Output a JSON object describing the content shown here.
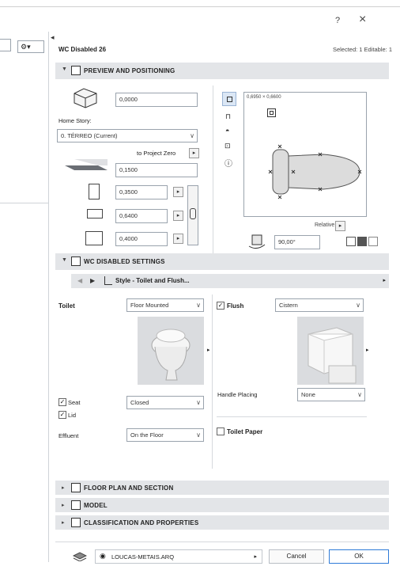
{
  "window": {
    "help": "?",
    "close": "×"
  },
  "sidebar": {
    "gear": "⚙▾"
  },
  "header": {
    "title": "WC Disabled 26",
    "selection": "Selected: 1 Editable: 1"
  },
  "preview_section": {
    "label": "PREVIEW AND POSITIONING",
    "elevation": "0,0000",
    "home_story_label": "Home Story:",
    "home_story_value": "0. TÉRREO (Current)",
    "to_project_zero": "to Project Zero",
    "offset": "0,1500",
    "width": "0,3500",
    "depth": "0,6400",
    "height": "0,4000",
    "size_readout": "0,6950 × 0,6600",
    "relative_label": "Relative",
    "angle": "90,00°"
  },
  "settings_section": {
    "label": "WC DISABLED SETTINGS",
    "style_label": "Style - Toilet and Flush..."
  },
  "toilet": {
    "label": "Toilet",
    "mount": "Floor Mounted",
    "seat_label": "Seat",
    "seat_value": "Closed",
    "lid_label": "Lid",
    "effluent_label": "Effluent",
    "effluent_value": "On the Floor"
  },
  "flush": {
    "label": "Flush",
    "type": "Cistern",
    "handle_label": "Handle Placing",
    "handle_value": "None",
    "paper_label": "Toilet Paper"
  },
  "collapsed_sections": [
    {
      "label": "FLOOR PLAN AND SECTION"
    },
    {
      "label": "MODEL"
    },
    {
      "label": "CLASSIFICATION AND PROPERTIES"
    }
  ],
  "footer": {
    "layer": "LOUCAS-METAIS.ARQ",
    "cancel": "Cancel",
    "ok": "OK"
  },
  "colors": {
    "accent": "#2f7bd8",
    "section_bg": "#e3e5e8",
    "border": "#9aa3ad"
  }
}
